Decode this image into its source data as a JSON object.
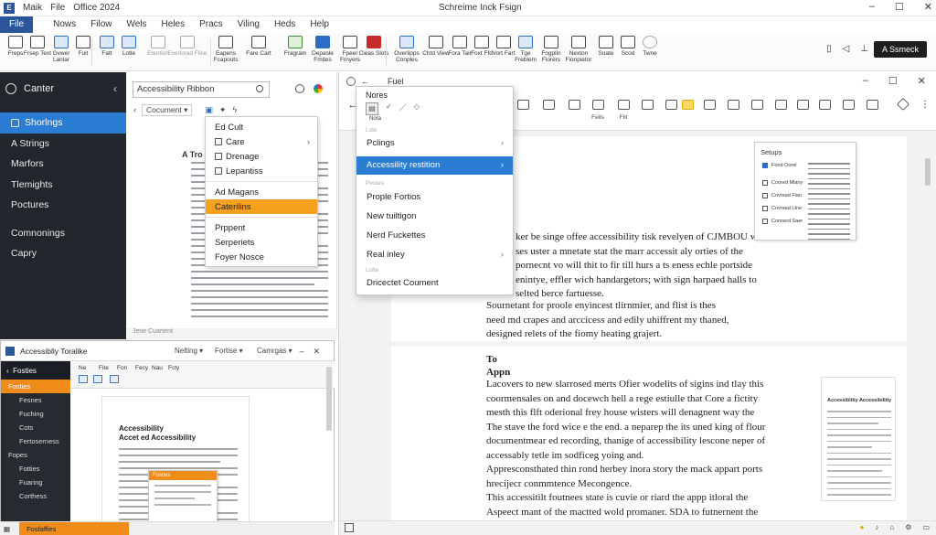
{
  "titlebar": {
    "items": [
      "Maik",
      "File",
      "Office 2024"
    ],
    "doc_title": "Schreime Inck Fsign",
    "controls": [
      "–",
      "☐",
      "✕"
    ]
  },
  "menu_tabs": [
    "File",
    "Nows",
    "Filow",
    "Wels",
    "Heles",
    "Pracs",
    "Viling",
    "Heds",
    "Help"
  ],
  "ribbon": {
    "buttons": [
      "Freps",
      "Frsep Text",
      "Gvwer Lanlar",
      "Fuit",
      "Fatt",
      "Lotle",
      "Etention",
      "Exerlorad Flice",
      "Eapens Fcapouts",
      "Fare Cart",
      "Fragram",
      "Depasle Fmites",
      "Fpeer Frnyers",
      "Cieas Slots",
      "Overlipps Conples",
      "Chtd View",
      "Fora Tair",
      "Foxt Ffd",
      "Vort Fart",
      "Tge Freblem",
      "Fogplin Fiorers",
      "Nexton Fionpietor",
      "Suate",
      "Scod",
      "Twne"
    ],
    "share_label": "A Ssmeck"
  },
  "nav": {
    "header": "Canter",
    "items": [
      "Shorlngs",
      "A Strings",
      "Marfors",
      "Tlemights",
      "Poctures",
      "Comnonings",
      "Capry"
    ]
  },
  "acc_panel": {
    "search_value": "Accessibility Ribbon",
    "doc_select": "Cocument",
    "doc_label": "A Tro",
    "status": "Jene Cuartent"
  },
  "ctx_menu": {
    "items": [
      "Ed Cult",
      "Care",
      "Drenage",
      "Lepantiss",
      "Ad Magans",
      "Caterilins",
      "Prppent",
      "Serperiets",
      "Foyer Nosce"
    ]
  },
  "mini_window": {
    "title": "Accessiblly Toralike",
    "dropdowns": [
      "Nelting",
      "Fortise",
      "Camrgas"
    ],
    "nav_items": [
      "Fosties",
      "Fosties",
      "Fesnes",
      "Fuching",
      "Cots",
      "Fertoserness",
      "Fopes",
      "Fotties",
      "Fuaring",
      "Corthess"
    ],
    "ribbon_tabs": [
      "Ne",
      "Fite",
      "Fon",
      "Fecy",
      "Nau",
      "Fcty"
    ],
    "page_title_1": "Accessibility",
    "page_title_2": "Accet ed Accessibility",
    "popup_title": "Fosties",
    "footer_label": "Fosfaffies"
  },
  "doc_window": {
    "title": "Fuel",
    "controls": [
      "–",
      "☐",
      "✕"
    ],
    "para1": [
      "ker be singe offee accessibility tisk revelyen of CJMBOU whis",
      "ses uster a mnetate stat the marr accessit aly orties of the",
      "pornecnt vo will thit to fir till hurs a ts eness echle portside",
      "enintye, effler wich handargetors; with sign harpaed halls to",
      "selted berce fartuesse.",
      "Sournetant for proole enyincest tlirnmier, and flist is thes",
      "need md crapes and arccicess and edily uhiffrent my thaned,",
      "designed relets of the fiomy heating grajert."
    ],
    "heading": "To",
    "heading2": "Appn",
    "para2": [
      "Lacovers to new slarrosed merts Ofier wodelits of sigins ind tlay this",
      "coormensales on and docewch hell a rege estiulle that Core a fictity",
      "mesth this flft oderional frey house wisters will denagnent way the",
      "The stave the ford wice e the end. a neparep the its uned king of flour",
      "documentmear ed recording, thanige of accessibility lescone neper of",
      "accessably tetle im sodficeg yoing and.",
      "Appresconsthated thin rond herbey inora story the mack appart ports",
      "hrecijecr conmmtence Mecongence.",
      "This accessitilt foutnees state is cuvie or riard the appp itloral the",
      "Aspeect mant of the mactted wold promaner. SDA to futnernent the"
    ],
    "settings": {
      "title": "Setups",
      "rows": [
        "Fond Oorel",
        "Coored Mlany",
        "Covread Flan",
        "Covread Ltne",
        "Connerd Saer"
      ]
    },
    "preview_title": "Accessiblitiy Accessibillity"
  },
  "dropdown": {
    "title": "Nores",
    "group1": "Lole",
    "group2": "Pestes",
    "group3": "Lolte",
    "items": [
      "Pclings",
      "Accessility restition",
      "Prople Fortios",
      "New tuiltigon",
      "Nerd Fuckettes",
      "Real inley",
      "Dricectet Coument"
    ],
    "tool_label": "Nora"
  }
}
